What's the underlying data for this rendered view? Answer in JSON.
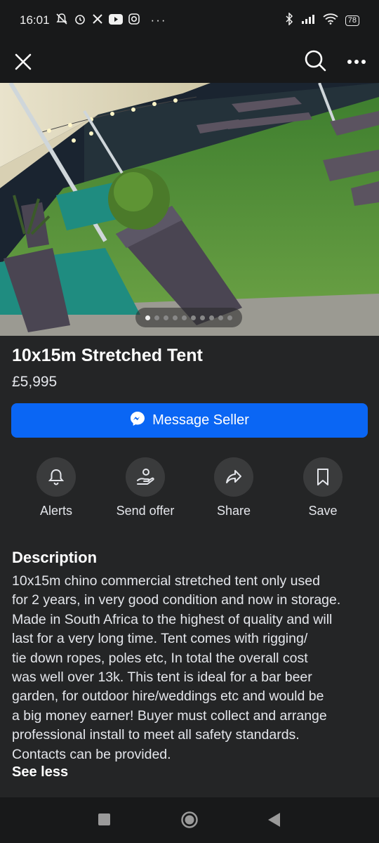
{
  "status_bar": {
    "time": "16:01",
    "notif_icons": [
      "bell-off-icon",
      "alarm-icon",
      "x-icon",
      "youtube-icon",
      "instagram-icon"
    ],
    "more": "···",
    "battery": "78"
  },
  "app_bar": {
    "close_icon": "close-icon",
    "search_icon": "search-icon",
    "more_icon": "more-horizontal-icon"
  },
  "gallery": {
    "image_count": 10,
    "active_index": 0
  },
  "listing": {
    "title": "10x15m Stretched Tent",
    "price": "£5,995"
  },
  "message_button": {
    "label": "Message Seller"
  },
  "actions": [
    {
      "label": "Alerts",
      "icon": "bell-icon"
    },
    {
      "label": "Send offer",
      "icon": "offer-icon"
    },
    {
      "label": "Share",
      "icon": "share-icon"
    },
    {
      "label": "Save",
      "icon": "bookmark-icon"
    }
  ],
  "description": {
    "heading": "Description",
    "lines": [
      "10x15m chino commercial stretched tent only used",
      "for 2 years, in very good condition and now in storage.",
      "Made in South Africa to the highest of quality and will",
      "last for a very long time. Tent comes with rigging/",
      "tie down ropes, poles etc, In total the overall cost",
      "was well over 13k. This tent is ideal for a bar beer",
      "garden, for outdoor hire/weddings etc and would be",
      "a big money earner! Buyer must collect and arrange",
      "professional install to meet all safety standards.",
      "Contacts can be provided."
    ],
    "toggle": "See less"
  },
  "colors": {
    "background": "#242526",
    "accent": "#0a66f4",
    "chip": "#3a3b3c"
  }
}
